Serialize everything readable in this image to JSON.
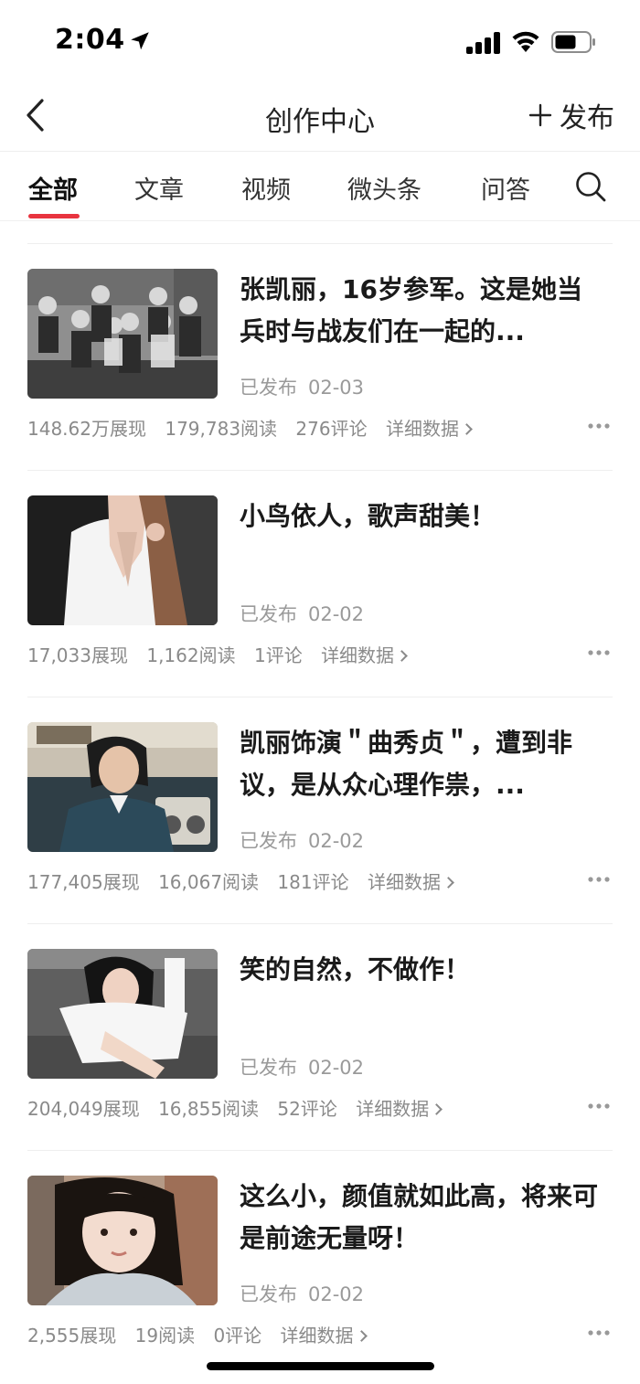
{
  "status_bar": {
    "time": "2:04"
  },
  "nav": {
    "title": "创作中心",
    "publish_label": "发布"
  },
  "tabs": [
    {
      "label": "全部",
      "active": true
    },
    {
      "label": "文章"
    },
    {
      "label": "视频"
    },
    {
      "label": "微头条"
    },
    {
      "label": "问答"
    }
  ],
  "accent_color": "#e8343f",
  "items": [
    {
      "title": "张凯丽，16岁参军。这是她当兵时与战友们在一起的...",
      "status": "已发布",
      "date": "02-03",
      "impressions": "148.62万展现",
      "reads": "179,783阅读",
      "comments": "276评论",
      "detail": "详细数据"
    },
    {
      "title": "小鸟依人，歌声甜美！",
      "status": "已发布",
      "date": "02-02",
      "impressions": "17,033展现",
      "reads": "1,162阅读",
      "comments": "1评论",
      "detail": "详细数据"
    },
    {
      "title": "凯丽饰演＂曲秀贞＂，遭到非议，是从众心理作祟，...",
      "status": "已发布",
      "date": "02-02",
      "impressions": "177,405展现",
      "reads": "16,067阅读",
      "comments": "181评论",
      "detail": "详细数据"
    },
    {
      "title": "笑的自然，不做作！",
      "status": "已发布",
      "date": "02-02",
      "impressions": "204,049展现",
      "reads": "16,855阅读",
      "comments": "52评论",
      "detail": "详细数据"
    },
    {
      "title": "这么小，颜值就如此高，将来可是前途无量呀！",
      "status": "已发布",
      "date": "02-02",
      "impressions": "2,555展现",
      "reads": "19阅读",
      "comments": "0评论",
      "detail": "详细数据"
    }
  ]
}
